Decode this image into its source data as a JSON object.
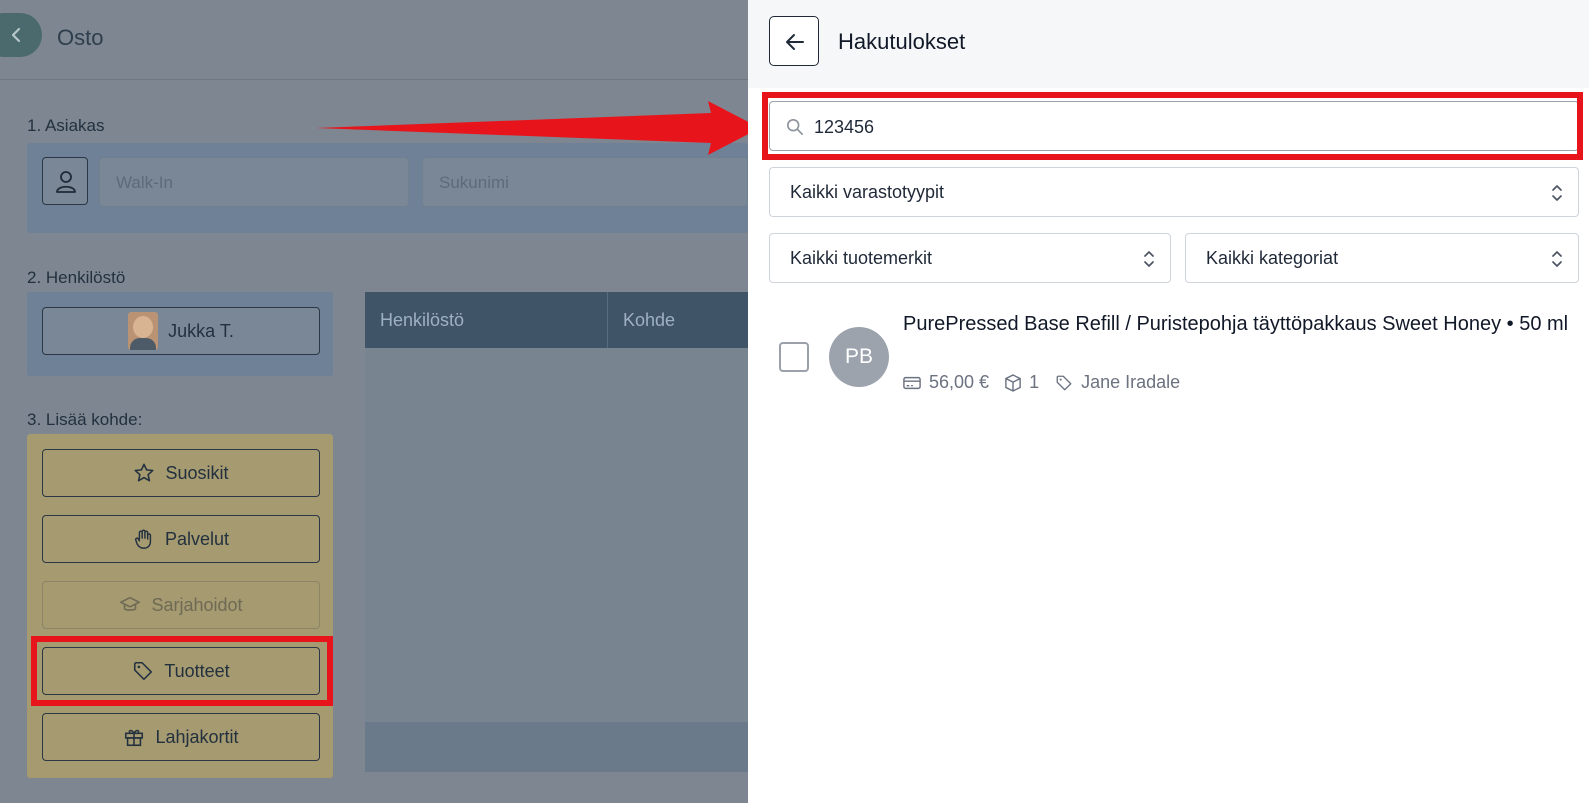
{
  "background": {
    "title": "Osto",
    "customer_section": {
      "label": "1. Asiakas",
      "first_name_placeholder": "Walk-In",
      "last_name_placeholder": "Sukunimi"
    },
    "staff_section": {
      "label": "2. Henkilöstö",
      "staff_button": "Jukka T.",
      "table_headers": [
        "Henkilöstö",
        "Kohde"
      ]
    },
    "add_section": {
      "label": "3. Lisää kohde:",
      "buttons": [
        {
          "label": "Suosikit",
          "icon": "star-icon"
        },
        {
          "label": "Palvelut",
          "icon": "hand-icon"
        },
        {
          "label": "Sarjahoidot",
          "icon": "graduation-cap-icon",
          "disabled": true
        },
        {
          "label": "Tuotteet",
          "icon": "tag-icon",
          "highlighted": true
        },
        {
          "label": "Lahjakortit",
          "icon": "gift-icon"
        }
      ]
    }
  },
  "drawer": {
    "title": "Hakutulokset",
    "search": {
      "value": "123456",
      "icon": "search-icon"
    },
    "filters": {
      "stock_type": "Kaikki varastotyypit",
      "brand": "Kaikki tuotemerkit",
      "category": "Kaikki kategoriat"
    },
    "results": [
      {
        "initials": "PB",
        "name": "PurePressed Base Refill / Puristepohja täyttöpakkaus Sweet Honey • 50 ml",
        "price": "56,00 €",
        "stock": "1",
        "brand": "Jane Iradale"
      }
    ]
  },
  "annotation_colors": {
    "highlight": "#e8141c"
  }
}
